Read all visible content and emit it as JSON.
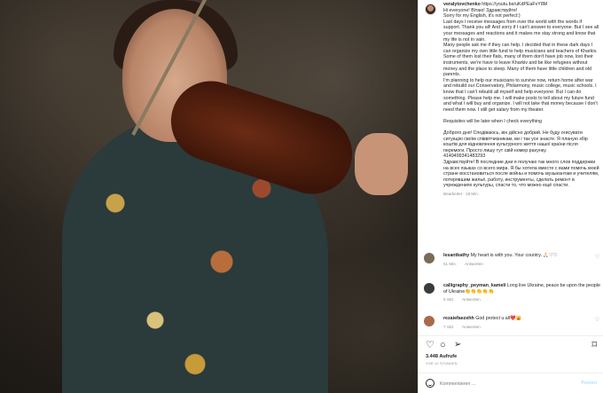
{
  "caption": {
    "username": "veralytovchenko",
    "link": "https://youtu.be/uKdPEaFvY8M",
    "lines_en": [
      "Hi everyone! Вітаю! Здравствуйте!",
      "Sorry for my English, it's not perfect:)",
      "Last days I receive messages from over the world with the words if support. Thank you all! And sorry if I can't answer to everyone. But I see all your messages and reactions and it makes me stay strong and know that my life is not in vain.",
      "Many people ask me if they can help. I decided that in these dark days I can organize my own little fund to help musicians and teachers of Kharkiv. Some of them lost their flats, many of them don't have job now, lost their instruments, we're have to leave Kharkiv and be like refugees without money and the place to sleep. Many of them have little children and old parents.",
      "I'm planning to help our musicians to survive now, return home after war and rebuild our Conservatory, Philarmony, music college, music schools. I know that I can't rebuild all myself and help everyone. But I can do something. Please help me. I will make posts to tell about my future fund and what I will buy and organize. I will not take that money because I don't need them now. I still get salary from my theater."
    ],
    "requisites": "Requisites will be later when I check everything",
    "lines_ua": "Доброго дня! Сподіваюсь, він дійсно добрий. Не буду огисувати ситуацію своїм співвітчизникам, ви і так усе знаєте. Я планую збір коштів для відновлення культурного життя нашої країни після перемоги. Просто лишу тут свій номер рахунку.",
    "card": "4149499341483293",
    "lines_ru": "Здравствуйте! В последние дни я получаю так много слов поддержки на всех языках со всего мира. Я бы хотела вместе с вами помочь моей стране восстановиться после войны и помочь музыкантам и учителям, потерявшим жильё, работу, инструменты, сделать ремонт в учреждениях культуры, спасти то, что можно ещё спасти.",
    "meta": "Bearbeitet · 18 Min."
  },
  "comments": [
    {
      "username": "lesantkathy",
      "text": "My heart is with you. Your country. 🙏🏻♡♡",
      "time": "51 Min.",
      "reply": "Antworten",
      "avatar_color": "#7a6a58"
    },
    {
      "username": "calligraphy_peyman_kameli",
      "text": "Long live Ukraine, peace be upon the people of Ukraine👏👏👏👏👏",
      "time": "5 Std.",
      "reply": "Antworten",
      "avatar_color": "#3b3b3b"
    },
    {
      "username": "rezaiefaezehh",
      "text": "God protect u all❤️🙀",
      "time": "7 Std.",
      "reply": "Antworten",
      "avatar_color": "#a86a4a"
    }
  ],
  "actions": {
    "like_icon": "heart-icon",
    "comment_icon": "comment-icon",
    "share_icon": "paper-plane-icon",
    "save_icon": "bookmark-icon"
  },
  "likes": "3.448 Aufrufe",
  "timestamp": "VOR 10 STUNDEN",
  "add_comment": {
    "placeholder": "Kommentieren ...",
    "post_label": "Posten"
  }
}
